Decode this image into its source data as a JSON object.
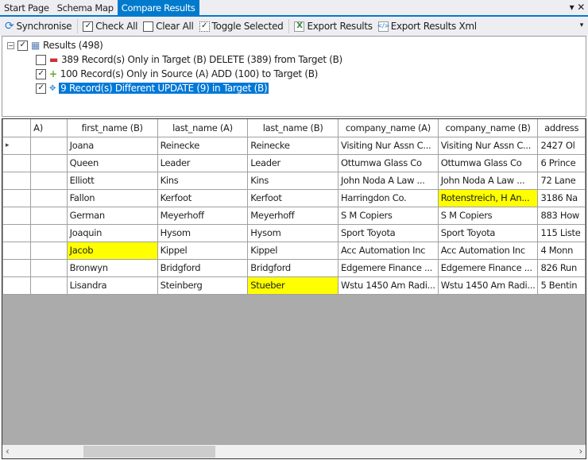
{
  "tabs": [
    {
      "label": "Start Page"
    },
    {
      "label": "Schema Map"
    },
    {
      "label": "Compare Results",
      "active": true
    }
  ],
  "tab_controls": {
    "dropdown": "▾",
    "close": "✕"
  },
  "toolbar": {
    "synchronise": "Synchronise",
    "check_all": "Check All",
    "clear_all": "Clear All",
    "toggle_selected": "Toggle Selected",
    "export_results": "Export Results",
    "export_results_xml": "Export Results Xml"
  },
  "tree": {
    "root": "Results (498)",
    "items": [
      {
        "label": "389 Record(s) Only in Target (B) DELETE (389) from Target (B)",
        "checked": false,
        "icon": "minus-icon",
        "color": "#c83232"
      },
      {
        "label": "100 Record(s) Only in Source (A) ADD (100) to Target (B)",
        "checked": true,
        "icon": "plus-icon",
        "color": "#6aa82c"
      },
      {
        "label": "9 Record(s) Different UPDATE (9) in Target (B)",
        "checked": true,
        "icon": "diff-icon",
        "color": "#3c8dde",
        "selected": true
      }
    ]
  },
  "grid": {
    "columns": [
      "A)",
      "first_name (B)",
      "last_name (A)",
      "last_name (B)",
      "company_name (A)",
      "company_name (B)",
      "address"
    ],
    "rows": [
      [
        "",
        "Joana",
        "Reinecke",
        "Reinecke",
        "Visiting Nur Assn C...",
        "Visiting Nur Assn C...",
        "2427 Ol"
      ],
      [
        "",
        "Queen",
        "Leader",
        "Leader",
        "Ottumwa Glass Co",
        "Ottumwa Glass Co",
        "6 Prince"
      ],
      [
        "",
        "Elliott",
        "Kins",
        "Kins",
        "John Noda A Law ...",
        "John Noda A Law ...",
        "72 Lane"
      ],
      [
        "",
        "Fallon",
        "Kerfoot",
        "Kerfoot",
        "Harringdon Co.",
        "Rotenstreich, H An...",
        "3186 Na"
      ],
      [
        "",
        "German",
        "Meyerhoff",
        "Meyerhoff",
        "S M Copiers",
        "S M Copiers",
        "883 How"
      ],
      [
        "",
        "Joaquin",
        "Hysom",
        "Hysom",
        "Sport Toyota",
        "Sport Toyota",
        "115 Liste"
      ],
      [
        "",
        "Jacob",
        "Kippel",
        "Kippel",
        "Acc Automation Inc",
        "Acc Automation Inc",
        "4 Monn"
      ],
      [
        "",
        "Bronwyn",
        "Bridgford",
        "Bridgford",
        "Edgemere Finance ...",
        "Edgemere Finance ...",
        "826 Run"
      ],
      [
        "",
        "Lisandra",
        "Steinberg",
        "Stueber",
        "Wstu 1450 Am Radi...",
        "Wstu 1450 Am Radi...",
        "5 Bentin"
      ]
    ],
    "highlighted": [
      [
        3,
        5
      ],
      [
        6,
        1
      ],
      [
        8,
        3
      ]
    ],
    "highlight_color": "#ffff00",
    "current_row_marker": "▸"
  }
}
